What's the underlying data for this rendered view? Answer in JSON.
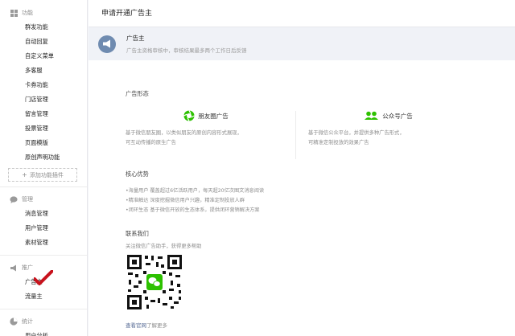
{
  "sidebar": {
    "sections": [
      {
        "title": "功能",
        "icon": "grid-icon",
        "items": [
          "群发功能",
          "自动回复",
          "自定义菜单",
          "多客服",
          "卡券功能",
          "门店管理",
          "留言管理",
          "投票管理",
          "页面模版",
          "原创声明功能"
        ]
      },
      {
        "title": "管理",
        "icon": "chat-bubble-icon",
        "items": [
          "消息管理",
          "用户管理",
          "素材管理"
        ]
      },
      {
        "title": "推广",
        "icon": "megaphone-icon",
        "items": [
          "广告主",
          "流量主"
        ]
      },
      {
        "title": "统计",
        "icon": "chart-icon",
        "items": [
          "用户分析"
        ]
      }
    ],
    "add_plugin_label": "添加功能插件",
    "active_item": "广告主"
  },
  "main": {
    "title": "申请开通广告主",
    "notice": {
      "title": "广告主",
      "subtitle": "广告主资格审核中，审核结果最多两个工作日后反馈"
    },
    "ad_forms": {
      "title": "广告形态",
      "left": {
        "label": "朋友圈广告",
        "desc_line1": "基于微信朋友圈，以类似朋友的原创内容形式展现，",
        "desc_line2": "可互动传播的原生广告"
      },
      "right": {
        "label": "公众号广告",
        "desc_line1": "基于微信公众平台，并提供多种广告形式，",
        "desc_line2": "可精准定制投放的效果广告"
      }
    },
    "advantages": {
      "title": "核心优势",
      "items": [
        "•海量用户 覆盖超过6亿活跃用户，每天超20亿次图文消息阅读",
        "•精准触达 深度挖掘微信用户兴趣，精准定制投放人群",
        "•闭环生态 基于微信开放的生态体系，提供闭环营销解决方案"
      ]
    },
    "contact": {
      "title": "联系我们",
      "subtitle": "关注微信广告助手，获得更多帮助",
      "more_link": "查看官网",
      "more_suffix": "了解更多"
    }
  },
  "colors": {
    "accent_link": "#576b95",
    "wechat_green": "#2dc100",
    "notice_bg": "#f0f2f7",
    "checkmark_red": "#c8131d"
  }
}
